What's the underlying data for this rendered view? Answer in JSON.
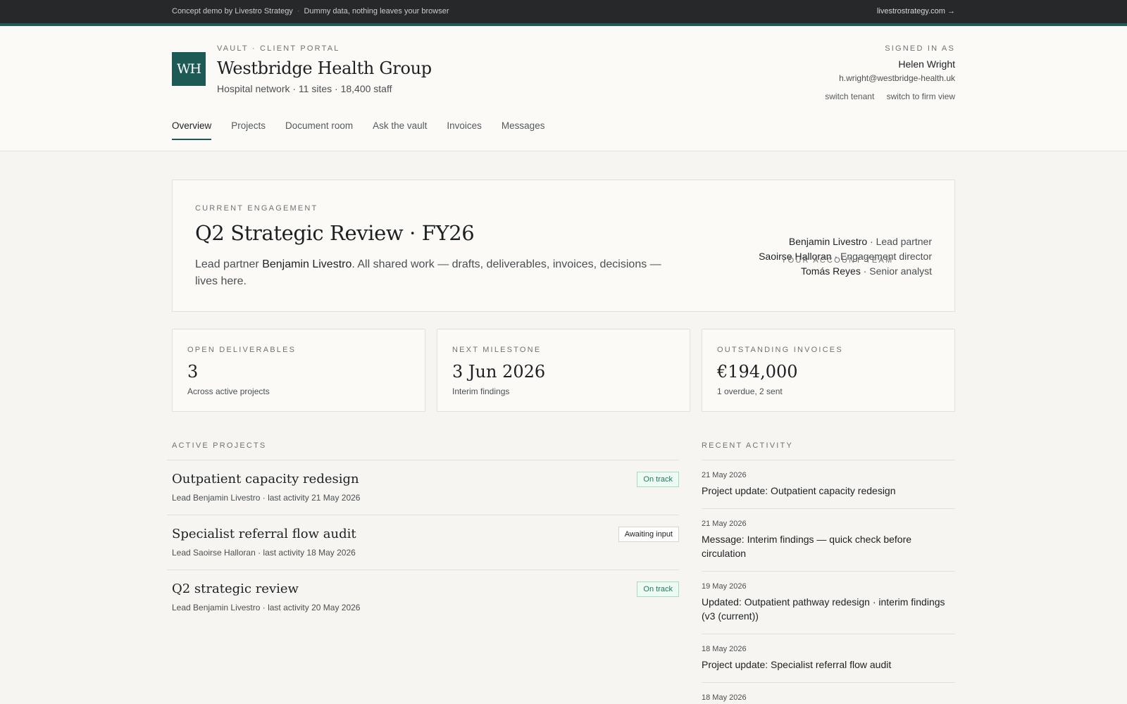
{
  "demo_bar": {
    "note": "Concept demo by Livestro Strategy",
    "separator": "·",
    "privacy": "Dummy data, nothing leaves your browser",
    "link": "livestrostrategy.com →"
  },
  "header": {
    "logo_initials": "WH",
    "eyebrow": "VAULT · CLIENT PORTAL",
    "tenant_name": "Westbridge Health Group",
    "tenant_sub": "Hospital network · 11 sites · 18,400 staff",
    "signed_in_label": "SIGNED IN AS",
    "user_name": "Helen Wright",
    "user_email": "h.wright@westbridge-health.uk",
    "switch_tenant": "switch tenant",
    "switch_firm": "switch to firm view"
  },
  "nav": {
    "tabs": [
      {
        "label": "Overview",
        "active": true
      },
      {
        "label": "Projects"
      },
      {
        "label": "Document room"
      },
      {
        "label": "Ask the vault"
      },
      {
        "label": "Invoices"
      },
      {
        "label": "Messages"
      }
    ]
  },
  "engagement": {
    "eyebrow": "CURRENT ENGAGEMENT",
    "title": "Q2 Strategic Review · FY26",
    "desc_prefix": "Lead partner ",
    "desc_partner": "Benjamin Livestro",
    "desc_suffix": ". All shared work — drafts, deliverables, invoices, decisions — lives here.",
    "team_label": "YOUR ACCOUNT TEAM",
    "team": [
      {
        "name": "Benjamin Livestro",
        "role": " · Lead partner"
      },
      {
        "name": "Saoirse Halloran",
        "role": " · Engagement director"
      },
      {
        "name": "Tomás Reyes",
        "role": " · Senior analyst"
      }
    ]
  },
  "stats": [
    {
      "label": "OPEN DELIVERABLES",
      "value": "3",
      "sub": "Across active projects"
    },
    {
      "label": "NEXT MILESTONE",
      "value": "3 Jun 2026",
      "sub": "Interim findings"
    },
    {
      "label": "OUTSTANDING INVOICES",
      "value": "€194,000",
      "sub": "1 overdue, 2 sent"
    }
  ],
  "projects": {
    "label": "ACTIVE PROJECTS",
    "items": [
      {
        "title": "Outpatient capacity redesign",
        "meta": "Lead Benjamin Livestro · last activity 21 May 2026",
        "status": "On track"
      },
      {
        "title": "Specialist referral flow audit",
        "meta": "Lead Saoirse Halloran · last activity 18 May 2026",
        "status": "Awaiting input"
      },
      {
        "title": "Q2 strategic review",
        "meta": "Lead Benjamin Livestro · last activity 20 May 2026",
        "status": "On track"
      }
    ]
  },
  "activity": {
    "label": "RECENT ACTIVITY",
    "items": [
      {
        "date": "21 May 2026",
        "text": "Project update: Outpatient capacity redesign"
      },
      {
        "date": "21 May 2026",
        "text": "Message: Interim findings — quick check before circulation"
      },
      {
        "date": "19 May 2026",
        "text": "Updated: Outpatient pathway redesign · interim findings (v3 (current))"
      },
      {
        "date": "18 May 2026",
        "text": "Project update: Specialist referral flow audit"
      },
      {
        "date": "18 May 2026",
        "text": ""
      }
    ]
  },
  "colors": {
    "accent": "#1d5a55",
    "on_track_text": "#1e7a55",
    "on_track_bg": "#eefaf4",
    "page_bg": "#f6f5f1",
    "demo_bar_bg": "#26282a"
  }
}
